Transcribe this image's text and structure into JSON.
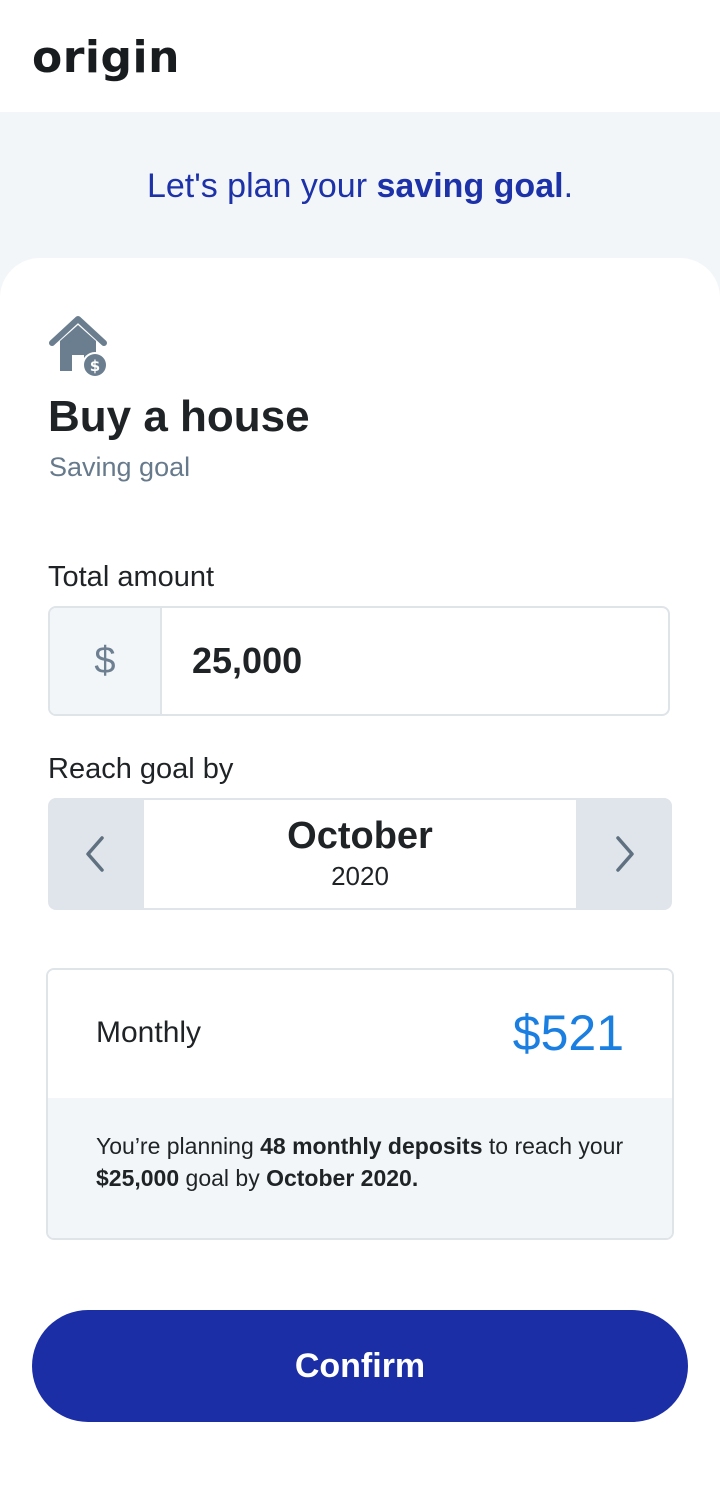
{
  "app": {
    "logo_text": "origin"
  },
  "hero": {
    "prefix": "Let's plan your ",
    "highlight": "saving goal",
    "suffix": "."
  },
  "goal": {
    "icon": "house-dollar-icon",
    "title": "Buy a house",
    "subtitle": "Saving goal"
  },
  "amount": {
    "label": "Total amount",
    "currency_symbol": "$",
    "value": "25,000"
  },
  "date": {
    "label": "Reach goal by",
    "month": "October",
    "year": "2020",
    "prev_icon": "chevron-left-icon",
    "next_icon": "chevron-right-icon"
  },
  "summary": {
    "monthly_label": "Monthly",
    "monthly_value": "$521",
    "text_1": "You’re planning ",
    "deposits": "48 monthly deposits",
    "text_2": " to reach your ",
    "goal_amount": "$25,000",
    "text_3": " goal by ",
    "goal_date": "October 2020."
  },
  "actions": {
    "confirm_label": "Confirm"
  },
  "colors": {
    "accent": "#1b2ea6",
    "highlight_blue": "#1a7fe0",
    "hero_bg": "#f3f6f9",
    "muted": "#677a8c"
  }
}
